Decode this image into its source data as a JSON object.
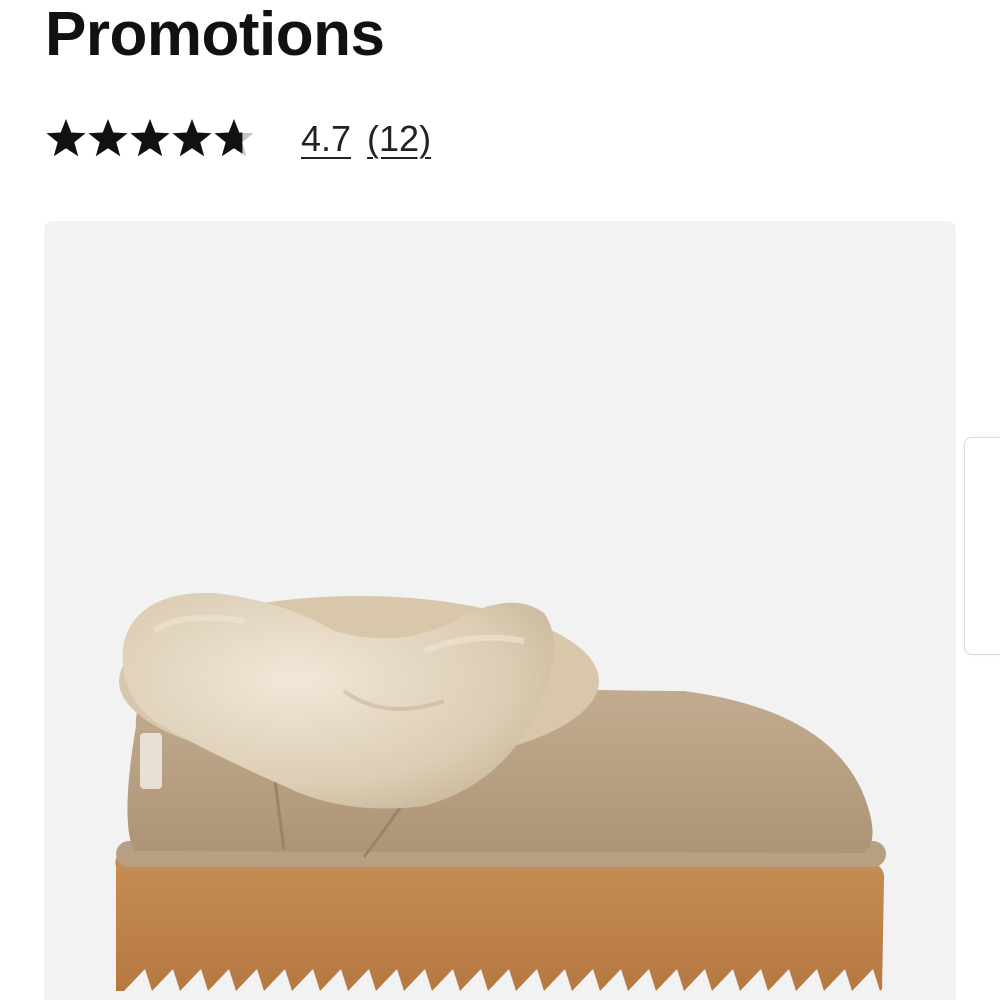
{
  "product": {
    "title": "Promotions",
    "rating_value": "4.7",
    "review_count": "(12)",
    "stars": {
      "filled": 4.7,
      "max": 5,
      "filled_color": "#111111",
      "empty_color": "#c4c4c4"
    }
  },
  "image": {
    "alt": "Chestnut suede slipper with faux fur collar and platform sole",
    "background": "#f2f2f2"
  },
  "side_panel": {
    "icon": "side-drawer-tab"
  }
}
